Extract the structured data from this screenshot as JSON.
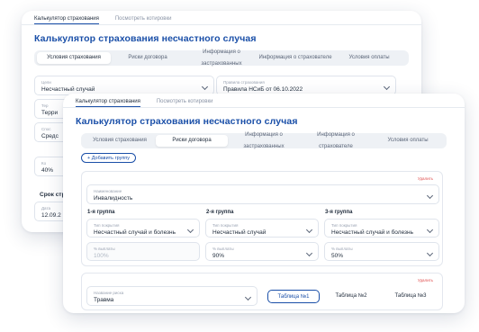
{
  "back": {
    "nav": [
      "Калькулятор страхования",
      "Посмотреть котировки"
    ],
    "title": "Калькулятор страхования несчастного случая",
    "tabs": [
      "Условия страхования",
      "Риски договора",
      "Информация о застрахованных",
      "Информация о страхователе",
      "Условия оплаты"
    ],
    "field1_label": "Цели",
    "field1_value": "Несчастный случай",
    "field2_label": "Правила страхования",
    "field2_value": "Правила НСиБ от 06.10.2022",
    "field3_label": "Тер",
    "field3_value": "Терри",
    "field4_label": "Спос",
    "field4_value": "Средс",
    "field5_label": "Ко",
    "field5_value": "40%",
    "section_label": "Срок стр",
    "field6_label": "Дата",
    "field6_value": "12.09.2"
  },
  "front": {
    "nav": [
      "Калькулятор страхования",
      "Посмотреть котировки"
    ],
    "title": "Калькулятор страхования несчастного случая",
    "tabs": [
      "Условия страхования",
      "Риски договора",
      "Информация о застрахованных",
      "Информация о страхователе",
      "Условия оплаты"
    ],
    "add_group": "+ Добавить группу",
    "delete": "Удалить",
    "risk_label": "Наименование",
    "risk_value": "Инвалидность",
    "groups": [
      {
        "name": "1-я группа",
        "cond_label": "Тип покрытия",
        "cond_value": "Несчастный случай и болезнь",
        "pct_label": "% выплаты",
        "pct_value": "100%"
      },
      {
        "name": "2-я группа",
        "cond_label": "Тип покрытия",
        "cond_value": "Несчастный случай",
        "pct_label": "% выплаты",
        "pct_value": "90%"
      },
      {
        "name": "3-я группа",
        "cond_label": "Тип покрытия",
        "cond_value": "Несчастный случай и болезнь",
        "pct_label": "% выплаты",
        "pct_value": "50%"
      }
    ],
    "delete2": "Удалить",
    "trauma_label": "Название риска",
    "trauma_value": "Травма",
    "tables": [
      "Таблица №1",
      "Таблица №2",
      "Таблица №3"
    ]
  }
}
